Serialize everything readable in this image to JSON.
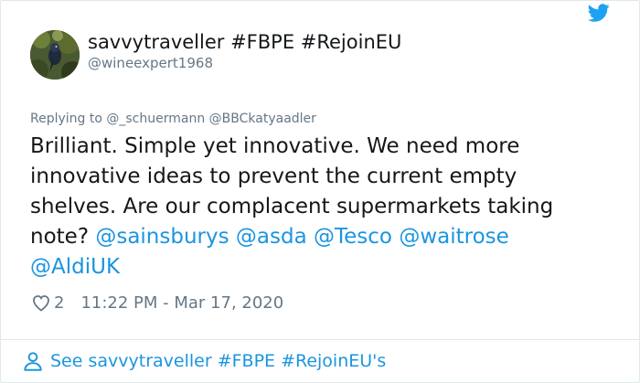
{
  "user": {
    "display_name": "savvytraveller #FBPE #RejoinEU",
    "handle": "@wineexpert1968"
  },
  "reply": {
    "prefix": "Replying to",
    "mentions": [
      "@_schuermann",
      "@BBCkatyaadler"
    ]
  },
  "tweet": {
    "lines": [
      "Brilliant. Simple yet innovative. We need more",
      "innovative ideas to prevent the current empty",
      "shelves. Are our complacent supermarkets taking"
    ],
    "line4_text": "note?",
    "line4_mentions": [
      "@sainsburys",
      "@asda",
      "@Tesco",
      "@waitrose"
    ],
    "line5_mentions": [
      "@AldiUK"
    ]
  },
  "meta": {
    "like_count": "2",
    "timestamp": "11:22 PM - Mar 17, 2020"
  },
  "footer": {
    "see_more_label": "See savvytraveller #FBPE #RejoinEU's"
  },
  "icons": {
    "brand": "twitter-bird-icon",
    "like": "heart-icon",
    "profile": "person-icon"
  },
  "colors": {
    "link": "#1b95e0",
    "text": "#14171a",
    "secondary": "#657786",
    "border": "#e1e8ed"
  }
}
